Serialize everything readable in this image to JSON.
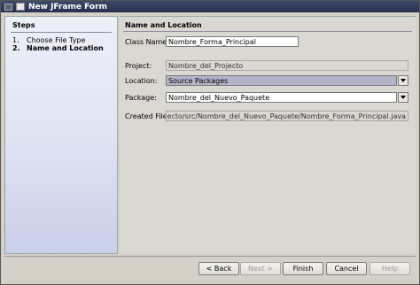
{
  "window": {
    "title": "New JFrame Form"
  },
  "steps": {
    "header": "Steps",
    "items": [
      {
        "num": "1.",
        "label": "Choose File Type"
      },
      {
        "num": "2.",
        "label": "Name and Location"
      }
    ]
  },
  "content": {
    "header": "Name and Location",
    "class_name": {
      "label": "Class Name:",
      "value": "Nombre_Forma_Principal"
    },
    "project": {
      "label": "Project:",
      "value": "Nombre_del_Projecto"
    },
    "location": {
      "label": "Location:",
      "value": "Source Packages"
    },
    "package": {
      "label": "Package:",
      "value": "Nombre_del_Nuevo_Paquete"
    },
    "created_file": {
      "label": "Created File:",
      "value": "_del_Projecto/src/Nombre_del_Nuevo_Paquete/Nombre_Forma_Principal.java"
    }
  },
  "buttons": {
    "back": "< Back",
    "next": "Next >",
    "finish": "Finish",
    "cancel": "Cancel",
    "help": "Help"
  }
}
